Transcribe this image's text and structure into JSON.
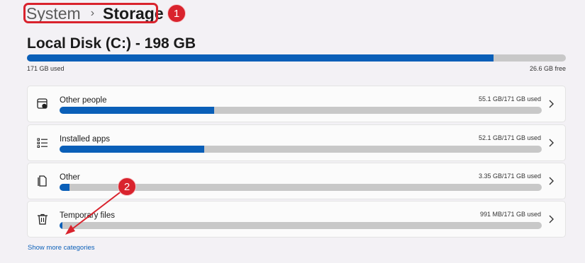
{
  "breadcrumb": {
    "parent": "System",
    "separator": "›",
    "current": "Storage"
  },
  "callouts": [
    "1",
    "2"
  ],
  "disk": {
    "title": "Local Disk (C:) - 198 GB",
    "used_label": "171 GB used",
    "free_label": "26.6 GB free",
    "used_fraction": 0.866
  },
  "categories": [
    {
      "label": "Other people",
      "usage": "55.1 GB/171 GB used",
      "fraction": 0.32,
      "icon": "other-people-icon"
    },
    {
      "label": "Installed apps",
      "usage": "52.1 GB/171 GB used",
      "fraction": 0.3,
      "icon": "apps-list-icon"
    },
    {
      "label": "Other",
      "usage": "3.35 GB/171 GB used",
      "fraction": 0.02,
      "icon": "document-icon"
    },
    {
      "label": "Temporary files",
      "usage": "991 MB/171 GB used",
      "fraction": 0.006,
      "icon": "trash-icon"
    }
  ],
  "show_more": "Show more categories",
  "colors": {
    "accent": "#0a5fb8",
    "callout": "#d9232d"
  }
}
